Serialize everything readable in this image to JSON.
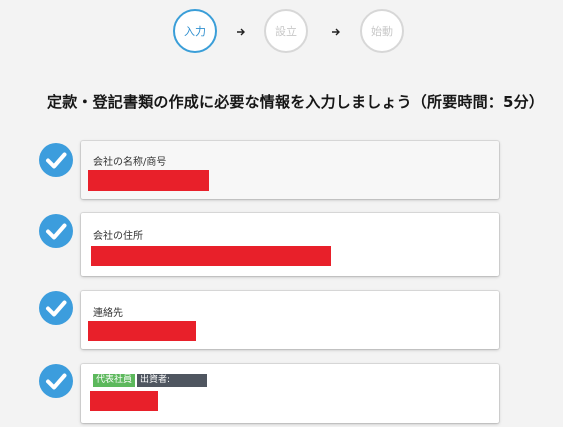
{
  "steps": [
    {
      "label": "入力",
      "state": "active"
    },
    {
      "label": "設立",
      "state": "inactive"
    },
    {
      "label": "始動",
      "state": "inactive"
    }
  ],
  "heading": "定款・登記書類の作成に必要な情報を入力しましょう（所要時間：5分）",
  "fields": [
    {
      "label": "会社の名称/商号",
      "status": "complete"
    },
    {
      "label": "会社の住所",
      "status": "complete"
    },
    {
      "label": "連絡先",
      "status": "complete"
    },
    {
      "status": "complete",
      "badges": {
        "role": "代表社員",
        "investor": "出資者:"
      }
    }
  ],
  "colors": {
    "accent": "#3a9ed8",
    "check": "#3c9ddd",
    "redaction": "#e8202a",
    "badge_green": "#5cb85c",
    "badge_dark": "#4f5660"
  },
  "icons": {
    "arrow": "arrow-right-icon",
    "check": "checkmark-circle-icon"
  }
}
